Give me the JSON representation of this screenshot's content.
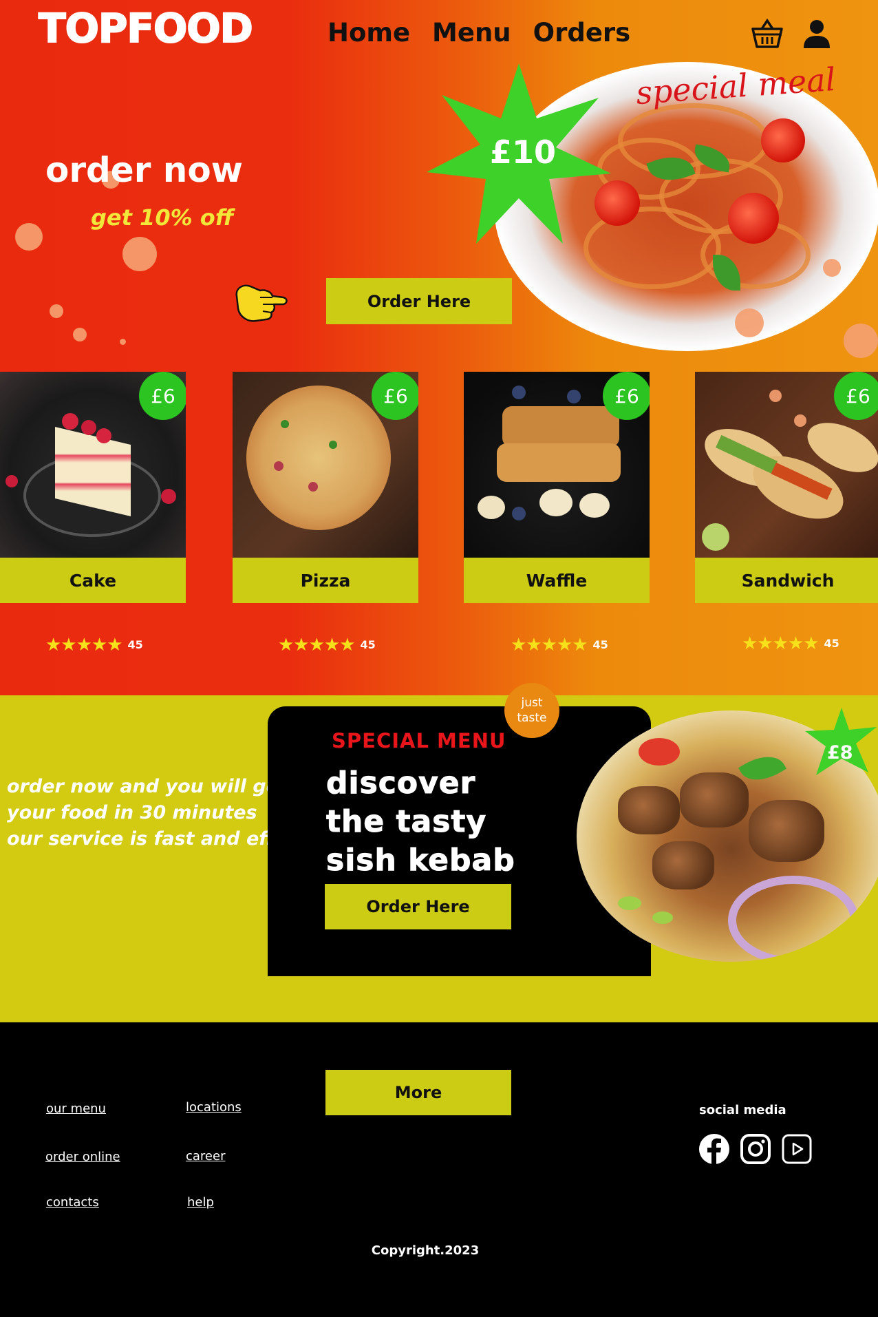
{
  "header": {
    "logo": "TOPFOOD",
    "nav": [
      "Home",
      "Menu",
      "Orders"
    ],
    "icons": [
      "basket-icon",
      "user-icon"
    ]
  },
  "hero": {
    "title": "order now",
    "subtitle": "get 10% off",
    "order_button": "Order Here",
    "special_label": "special meal",
    "special_price": "£10"
  },
  "menu_cards": [
    {
      "name": "Cake",
      "price": "£6",
      "stars": "★★★★★",
      "rating_count": "45"
    },
    {
      "name": "Pizza",
      "price": "£6",
      "stars": "★★★★★",
      "rating_count": "45"
    },
    {
      "name": "Waffle",
      "price": "£6",
      "stars": "★★★★★",
      "rating_count": "45"
    },
    {
      "name": "Sandwich",
      "price": "£6",
      "stars": "★★★★★",
      "rating_count": "45"
    }
  ],
  "special_section": {
    "promo_lines": [
      "order now and you will get",
      "your food in 30 minutes",
      "our service is fast and effective"
    ],
    "badge_lines": [
      "just",
      "taste"
    ],
    "title": "SPECIAL MENU",
    "headline_lines": [
      "discover",
      "the tasty",
      "sish kebab"
    ],
    "order_button": "Order Here",
    "price": "£8"
  },
  "footer": {
    "more_button": "More",
    "links_col1": [
      "our menu",
      "order online",
      "contacts"
    ],
    "links_col2": [
      "locations",
      "career",
      "help"
    ],
    "social_title": "social media",
    "social_icons": [
      "facebook-icon",
      "instagram-icon",
      "youtube-icon"
    ],
    "copyright": "Copyright.2023"
  },
  "colors": {
    "hero_red": "#ea2a0f",
    "hero_orange": "#ee9410",
    "accent_yellow": "#cccc14",
    "section_yellow": "#d2cb12",
    "price_green": "#2bc421",
    "special_red": "#e8151b"
  }
}
